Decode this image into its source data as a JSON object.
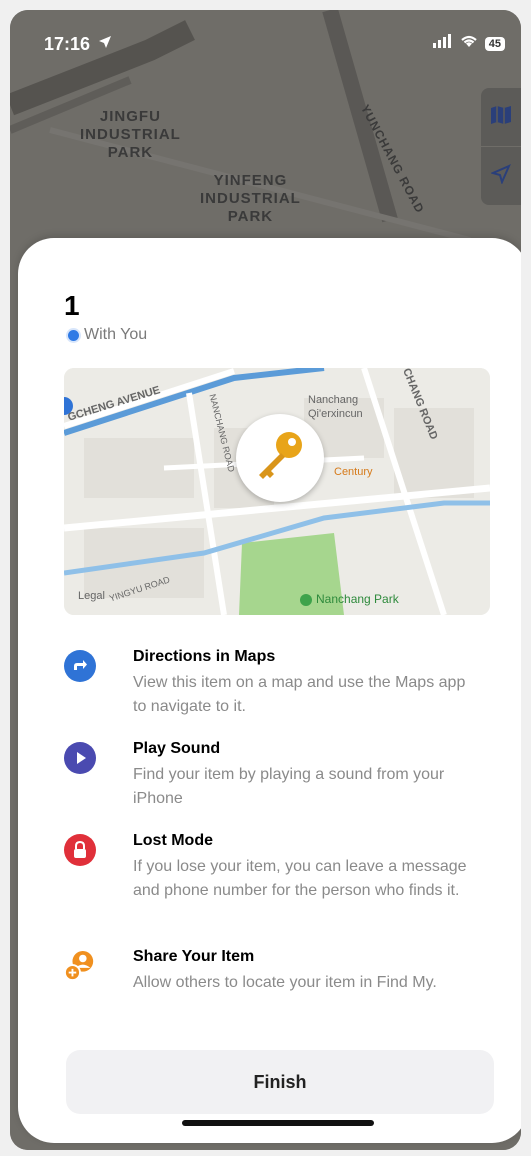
{
  "status_bar": {
    "time": "17:16",
    "battery": "45"
  },
  "background_map": {
    "labels": [
      "JINGFU",
      "INDUSTRIAL",
      "PARK",
      "YINFENG",
      "INDUSTRIAL",
      "PARK",
      "YUNCHANG ROAD"
    ]
  },
  "sheet": {
    "title": "1",
    "status": "With You",
    "mini_map": {
      "labels": {
        "avenue": "GCHENG AVENUE",
        "road1": "NANCHANG ROAD",
        "road2": "CHANG ROAD",
        "area": "Nanchang",
        "area2": "Qi'erxincun",
        "century": "Century",
        "park": "Nanchang Park",
        "legal": "Legal",
        "yinyu": "YINGYU ROAD"
      }
    },
    "actions": [
      {
        "title": "Directions in Maps",
        "description": "View this item on a map and use the Maps app to navigate to it.",
        "color": "#2f73d6"
      },
      {
        "title": "Play Sound",
        "description": "Find your item by playing a sound from your iPhone",
        "color": "#4a4ab0"
      },
      {
        "title": "Lost Mode",
        "description": "If you lose your item, you can leave a message and phone number for the person who finds it.",
        "color": "#e0303a"
      },
      {
        "title": "Share Your Item",
        "description": "Allow others to locate your item in Find My.",
        "color": "#f0901f"
      }
    ],
    "finish_label": "Finish"
  }
}
